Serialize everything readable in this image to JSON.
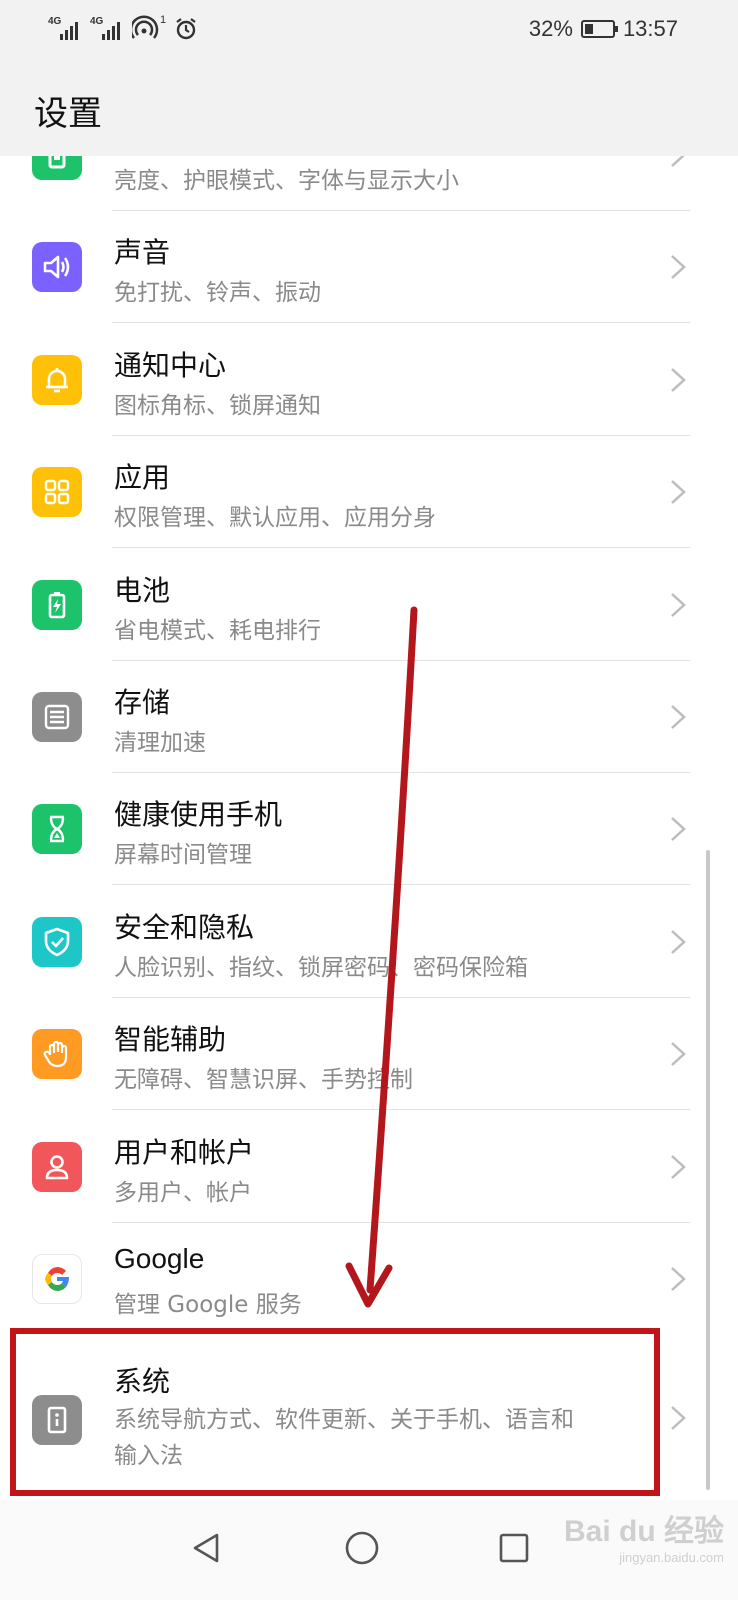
{
  "status_bar": {
    "signal1_tag": "4G",
    "signal2_tag": "4G",
    "hotspot_count": "1",
    "battery_percent": "32%",
    "battery_level": 0.32,
    "time": "13:57"
  },
  "header": {
    "title": "设置"
  },
  "items": [
    {
      "title": "",
      "subtitle": "亮度、护眼模式、字体与显示大小",
      "icon": "display-icon",
      "color": "#1cc36b"
    },
    {
      "title": "声音",
      "subtitle": "免打扰、铃声、振动",
      "icon": "speaker-icon",
      "color": "#7b61ff"
    },
    {
      "title": "通知中心",
      "subtitle": "图标角标、锁屏通知",
      "icon": "bell-icon",
      "color": "#ffc107"
    },
    {
      "title": "应用",
      "subtitle": "权限管理、默认应用、应用分身",
      "icon": "apps-grid-icon",
      "color": "#ffc107"
    },
    {
      "title": "电池",
      "subtitle": "省电模式、耗电排行",
      "icon": "battery-icon",
      "color": "#1cc36b"
    },
    {
      "title": "存储",
      "subtitle": "清理加速",
      "icon": "storage-icon",
      "color": "#8d8d8d"
    },
    {
      "title": "健康使用手机",
      "subtitle": "屏幕时间管理",
      "icon": "hourglass-icon",
      "color": "#1cc36b"
    },
    {
      "title": "安全和隐私",
      "subtitle": "人脸识别、指纹、锁屏密码、密码保险箱",
      "icon": "shield-icon",
      "color": "#1ec7c7"
    },
    {
      "title": "智能辅助",
      "subtitle": "无障碍、智慧识屏、手势控制",
      "icon": "hand-icon",
      "color": "#ff9a22"
    },
    {
      "title": "用户和帐户",
      "subtitle": "多用户、帐户",
      "icon": "user-icon",
      "color": "#f0565a"
    },
    {
      "title": "Google",
      "subtitle": "管理 Google 服务",
      "icon": "google-icon",
      "color": "#ffffff"
    },
    {
      "title": "系统",
      "subtitle": "系统导航方式、软件更新、关于手机、语言和",
      "subtitle2": "输入法",
      "icon": "info-icon",
      "color": "#8d8d8d"
    }
  ],
  "watermark": {
    "text": "Bai du 经验",
    "sub": "jingyan.baidu.com"
  }
}
